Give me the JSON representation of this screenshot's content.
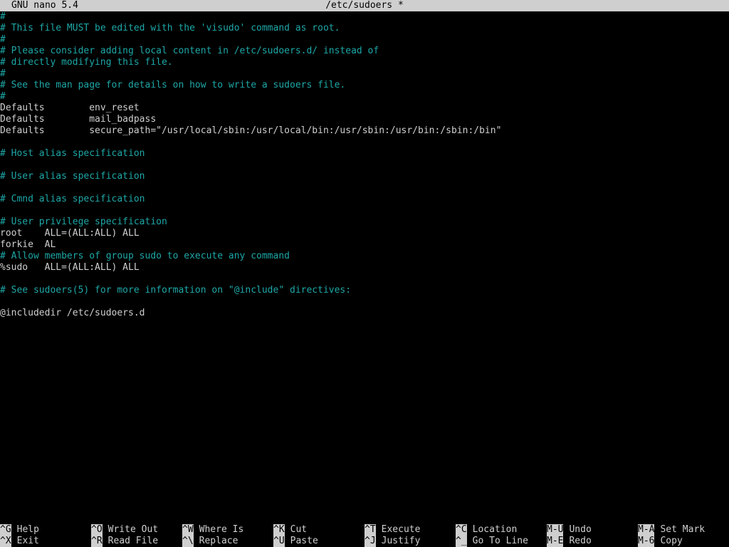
{
  "titlebar": {
    "app": "GNU nano 5.4",
    "file": "/etc/sudoers *"
  },
  "editor": {
    "lines": [
      {
        "text": "#",
        "type": "comment"
      },
      {
        "text": "# This file MUST be edited with the 'visudo' command as root.",
        "type": "comment"
      },
      {
        "text": "#",
        "type": "comment"
      },
      {
        "text": "# Please consider adding local content in /etc/sudoers.d/ instead of",
        "type": "comment"
      },
      {
        "text": "# directly modifying this file.",
        "type": "comment"
      },
      {
        "text": "#",
        "type": "comment"
      },
      {
        "text": "# See the man page for details on how to write a sudoers file.",
        "type": "comment"
      },
      {
        "text": "#",
        "type": "comment"
      },
      {
        "text": "Defaults        env_reset",
        "type": "code"
      },
      {
        "text": "Defaults        mail_badpass",
        "type": "code"
      },
      {
        "text": "Defaults        secure_path=\"/usr/local/sbin:/usr/local/bin:/usr/sbin:/usr/bin:/sbin:/bin\"",
        "type": "code"
      },
      {
        "text": "",
        "type": "code"
      },
      {
        "text": "# Host alias specification",
        "type": "comment"
      },
      {
        "text": "",
        "type": "code"
      },
      {
        "text": "# User alias specification",
        "type": "comment"
      },
      {
        "text": "",
        "type": "code"
      },
      {
        "text": "# Cmnd alias specification",
        "type": "comment"
      },
      {
        "text": "",
        "type": "code"
      },
      {
        "text": "# User privilege specification",
        "type": "comment"
      },
      {
        "text": "root    ALL=(ALL:ALL) ALL",
        "type": "code"
      },
      {
        "text": "forkie  AL",
        "type": "code"
      },
      {
        "text": "# Allow members of group sudo to execute any command",
        "type": "comment"
      },
      {
        "text": "%sudo   ALL=(ALL:ALL) ALL",
        "type": "code"
      },
      {
        "text": "",
        "type": "code"
      },
      {
        "text": "# See sudoers(5) for more information on \"@include\" directives:",
        "type": "comment"
      },
      {
        "text": "",
        "type": "code"
      },
      {
        "text": "@includedir /etc/sudoers.d",
        "type": "code"
      }
    ]
  },
  "shortcuts": {
    "row1": [
      {
        "key": "^G",
        "label": "Help"
      },
      {
        "key": "^O",
        "label": "Write Out"
      },
      {
        "key": "^W",
        "label": "Where Is"
      },
      {
        "key": "^K",
        "label": "Cut"
      },
      {
        "key": "^T",
        "label": "Execute"
      },
      {
        "key": "^C",
        "label": "Location"
      },
      {
        "key": "M-U",
        "label": "Undo"
      },
      {
        "key": "M-A",
        "label": "Set Mark"
      }
    ],
    "row2": [
      {
        "key": "^X",
        "label": "Exit"
      },
      {
        "key": "^R",
        "label": "Read File"
      },
      {
        "key": "^\\",
        "label": "Replace"
      },
      {
        "key": "^U",
        "label": "Paste"
      },
      {
        "key": "^J",
        "label": "Justify"
      },
      {
        "key": "^_",
        "label": "Go To Line"
      },
      {
        "key": "M-E",
        "label": "Redo"
      },
      {
        "key": "M-6",
        "label": "Copy"
      }
    ]
  }
}
